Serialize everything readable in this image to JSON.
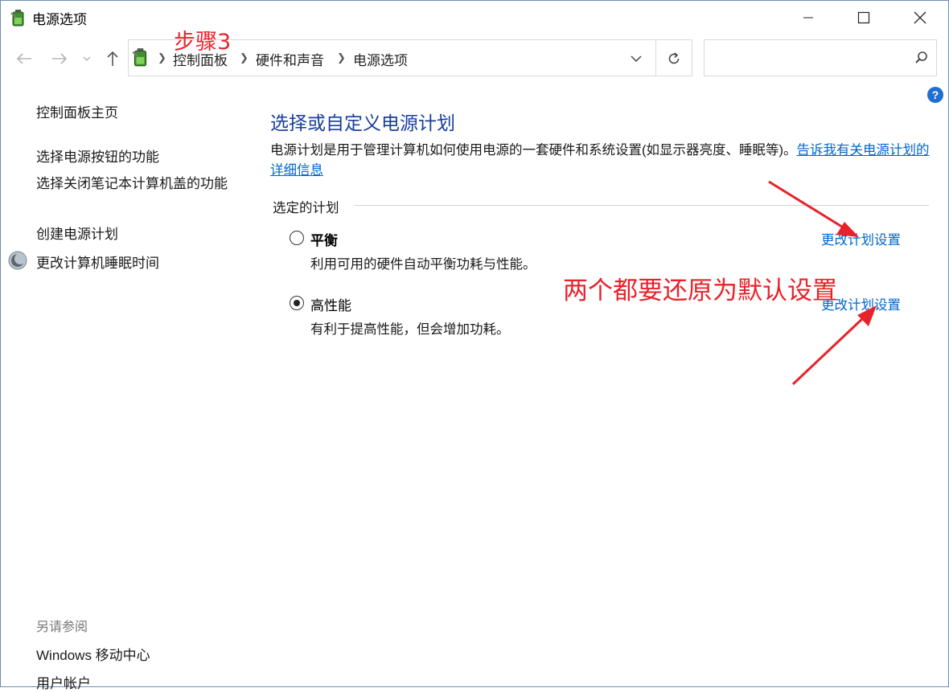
{
  "window": {
    "title": "电源选项",
    "icon": "power-options-battery-icon"
  },
  "caption_buttons": [
    "minimize-icon",
    "maximize-icon",
    "close-icon"
  ],
  "nav": {
    "back_icon": "arrow-left-icon",
    "forward_icon": "arrow-right-icon",
    "recent_icon": "chevron-down-icon",
    "up_icon": "arrow-up-icon",
    "breadcrumb": [
      "控制面板",
      "硬件和声音",
      "电源选项"
    ],
    "dropdown_icon": "chevron-down-icon",
    "refresh_icon": "refresh-icon",
    "search_placeholder": "",
    "search_icon": "search-icon"
  },
  "help_label": "?",
  "sidebar": {
    "home": "控制面板主页",
    "links": [
      "选择电源按钮的功能",
      "选择关闭笔记本计算机盖的功能",
      "创建电源计划",
      "更改计算机睡眠时间"
    ],
    "see_also_label": "另请参阅",
    "see_also": [
      "Windows 移动中心",
      "用户帐户"
    ]
  },
  "main": {
    "title": "选择或自定义电源计划",
    "description": "电源计划是用于管理计算机如何使用电源的一套硬件和系统设置(如显示器亮度、睡眠等)。",
    "description_link": "告诉我有关电源计划的详细信息",
    "group_label": "选定的计划",
    "plans": [
      {
        "name": "平衡",
        "description": "利用可用的硬件自动平衡功耗与性能。",
        "selected": false,
        "link": "更改计划设置"
      },
      {
        "name": "高性能",
        "description": "有利于提高性能，但会增加功耗。",
        "selected": true,
        "link": "更改计划设置"
      }
    ]
  },
  "annotations": {
    "step": "步骤3",
    "note": "两个都要还原为默认设置",
    "color": "#e8222a"
  }
}
